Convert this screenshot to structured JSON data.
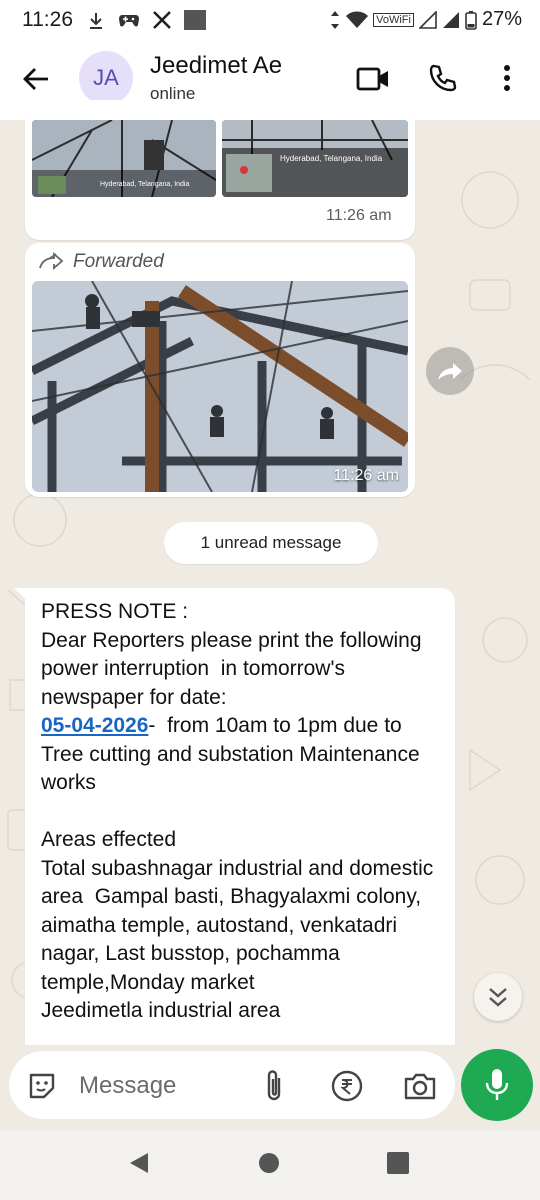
{
  "status_bar": {
    "time": "11:26",
    "battery": "27%",
    "wifi_label": "VoWiFi",
    "icons": [
      "download-icon",
      "game-controller-icon",
      "x-logo-icon",
      "square-app-icon",
      "data-arrows-icon",
      "wifi-icon",
      "signal-icon",
      "signal-icon",
      "battery-icon"
    ]
  },
  "header": {
    "avatar_initials": "JA",
    "contact_name": "Jeedimet Ae",
    "contact_status": "online",
    "icons": [
      "back-arrow-icon",
      "video-call-icon",
      "phone-icon",
      "more-vert-icon"
    ]
  },
  "messages": [
    {
      "type": "image-pair",
      "caption_left": "Hyderabad, Telangana, India",
      "caption_right": "Hyderabad, Telangana, India",
      "time": "11:26 am"
    },
    {
      "type": "forwarded-image",
      "forwarded_label": "Forwarded",
      "time": "11:26 am"
    }
  ],
  "unread_divider": "1 unread message",
  "press_note": {
    "line1": "PRESS NOTE :",
    "line2": "Dear Reporters please print the following power interruption  in tomorrow's newspaper for date:",
    "date_link": "05-04-2026",
    "line3": "-  from 10am to 1pm due to Tree cutting and substation Maintenance works",
    "line4": "Areas effected",
    "line5": "Total subashnagar industrial and domestic area  Gampal basti, Bhagyalaxmi colony, aimatha temple, autostand, venkatadri nagar, Last busstop, pochamma temple,Monday market",
    "line6": "Jeedimetla industrial area"
  },
  "composer": {
    "placeholder": "Message",
    "icons": [
      "sticker-icon",
      "attach-icon",
      "rupee-payment-icon",
      "camera-icon",
      "mic-icon"
    ]
  },
  "colors": {
    "accent_green": "#1ea952",
    "link_blue": "#1a66c4",
    "chat_bg": "#efeae2",
    "avatar_bg": "#e6dff9"
  }
}
